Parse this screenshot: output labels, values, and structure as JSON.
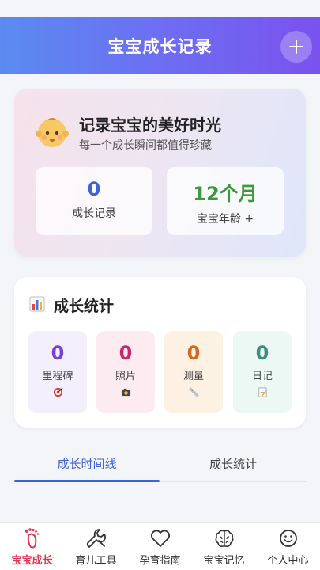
{
  "header": {
    "title": "宝宝成长记录",
    "add_icon": "plus-icon"
  },
  "hero": {
    "icon": "baby-face-icon",
    "title": "记录宝宝的美好时光",
    "subtitle": "每一个成长瞬间都值得珍藏",
    "records": {
      "value": "0",
      "label": "成长记录"
    },
    "age": {
      "value": "12个月",
      "label": "宝宝年龄 +"
    }
  },
  "stats": {
    "icon": "bar-chart-icon",
    "title": "成长统计",
    "cards": [
      {
        "value": "0",
        "label": "里程碑",
        "icon": "target-icon",
        "color": "#7a3fd8",
        "bg": "#f4effc"
      },
      {
        "value": "0",
        "label": "照片",
        "icon": "camera-icon",
        "color": "#c42a6a",
        "bg": "#fcecf2"
      },
      {
        "value": "0",
        "label": "测量",
        "icon": "ruler-icon",
        "color": "#d4661e",
        "bg": "#fdf1e4"
      },
      {
        "value": "0",
        "label": "日记",
        "icon": "memo-icon",
        "color": "#3a8f7a",
        "bg": "#ecf8f3"
      }
    ]
  },
  "tabs": [
    {
      "label": "成长时间线",
      "active": true
    },
    {
      "label": "成长统计",
      "active": false
    }
  ],
  "bottom_nav": [
    {
      "label": "宝宝成长",
      "icon": "footprint-icon",
      "active": true
    },
    {
      "label": "育儿工具",
      "icon": "wrench-icon",
      "active": false
    },
    {
      "label": "孕育指南",
      "icon": "heart-icon",
      "active": false
    },
    {
      "label": "宝宝记忆",
      "icon": "brain-icon",
      "active": false
    },
    {
      "label": "个人中心",
      "icon": "smiley-icon",
      "active": false
    }
  ],
  "colors": {
    "accent": "#3e63d6",
    "active_nav": "#e0364f",
    "green": "#3a9a3a"
  }
}
